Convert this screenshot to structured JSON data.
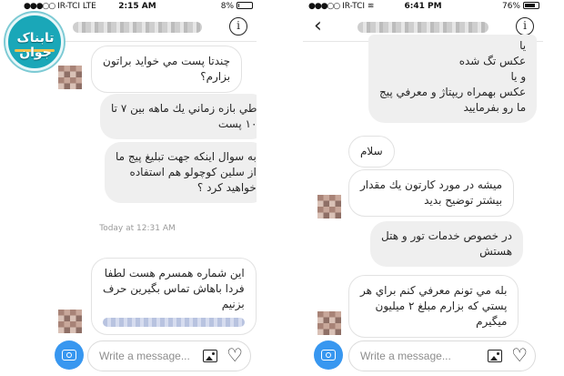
{
  "left_phone": {
    "status": {
      "carrier": "IR-TCI",
      "network": "LTE",
      "time": "2:15 AM",
      "battery": "8%",
      "battery_level": 0.08
    },
    "header": {
      "info_icon": "info-icon"
    },
    "messages": [
      {
        "lines": [
          "چندتا پست مي خوايد براتون",
          "بزارم؟"
        ]
      },
      {
        "lines": [
          "طي بازه زماني يك ماهه بين ۷ تا",
          "۱۰ پست"
        ]
      },
      {
        "lines": [
          "به سوال اينكه جهت تبليغ پيج ما",
          "از سلين كوچولو هم استفاده",
          "خواهيد كرد ؟"
        ]
      },
      {
        "lines": [
          "اين شماره همسرم هست لطفا",
          "فردا باهاش تماس بگيرين حرف",
          "بزنيم"
        ]
      }
    ],
    "timestamp": "Today at 12:31 AM",
    "composer": {
      "placeholder": "Write a message...",
      "camera_icon": "camera-icon",
      "gallery_icon": "gallery-icon",
      "heart_icon": "heart-icon"
    }
  },
  "right_phone": {
    "status": {
      "carrier": "IR-TCI",
      "time": "6:41 PM",
      "battery": "76%",
      "battery_level": 0.76
    },
    "header": {
      "back_icon": "back-arrow-icon",
      "info_icon": "info-icon"
    },
    "messages": [
      {
        "lines": [
          "يا",
          "عكس تگ شده",
          "و يا",
          "عكس بهمراه ريپتاژ و معرفي پيج",
          "ما رو بفرماييد"
        ]
      },
      {
        "lines": [
          "سلام"
        ]
      },
      {
        "lines": [
          "ميشه در مورد كارتون يك مقدار",
          "بيشتر توضيح بديد"
        ]
      },
      {
        "lines": [
          "در خصوص خدمات تور و هتل",
          "هستش"
        ]
      },
      {
        "lines": [
          "بله مي تونم معرفي كنم براي هر",
          "پستي كه بزارم مبلغ ۲ ميليون",
          "ميگيرم"
        ]
      }
    ],
    "composer": {
      "placeholder": "Write a message...",
      "camera_icon": "camera-icon",
      "gallery_icon": "gallery-icon",
      "heart_icon": "heart-icon"
    }
  },
  "logo": {
    "text": "تابناک جوان",
    "colors": {
      "ring": "#1aa7b8",
      "accent": "#f2c14e"
    }
  },
  "colors": {
    "bubble_gray": "#efefef",
    "camera_blue": "#3897f0",
    "timestamp_gray": "#9a9a9a"
  }
}
